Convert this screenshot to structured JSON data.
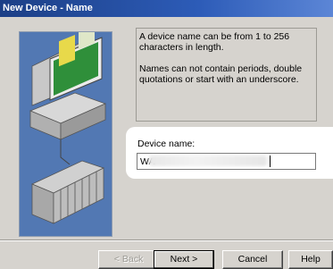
{
  "window": {
    "title": "New Device - Name"
  },
  "info": {
    "paragraph1": "A device name can be from 1 to 256 characters in length.",
    "paragraph2": "Names can not contain periods, double quotations or start with an underscore."
  },
  "device_name": {
    "label": "Device name:",
    "value": "WA"
  },
  "buttons": {
    "back": "< Back",
    "next": "Next >",
    "cancel": "Cancel",
    "help": "Help"
  },
  "colors": {
    "title_bar": "#2d5cb8",
    "dialog_bg": "#d6d3ce",
    "illustration_bg": "#5278b3"
  },
  "icons": {
    "illustration": "computer-and-plc-hardware-illustration"
  }
}
